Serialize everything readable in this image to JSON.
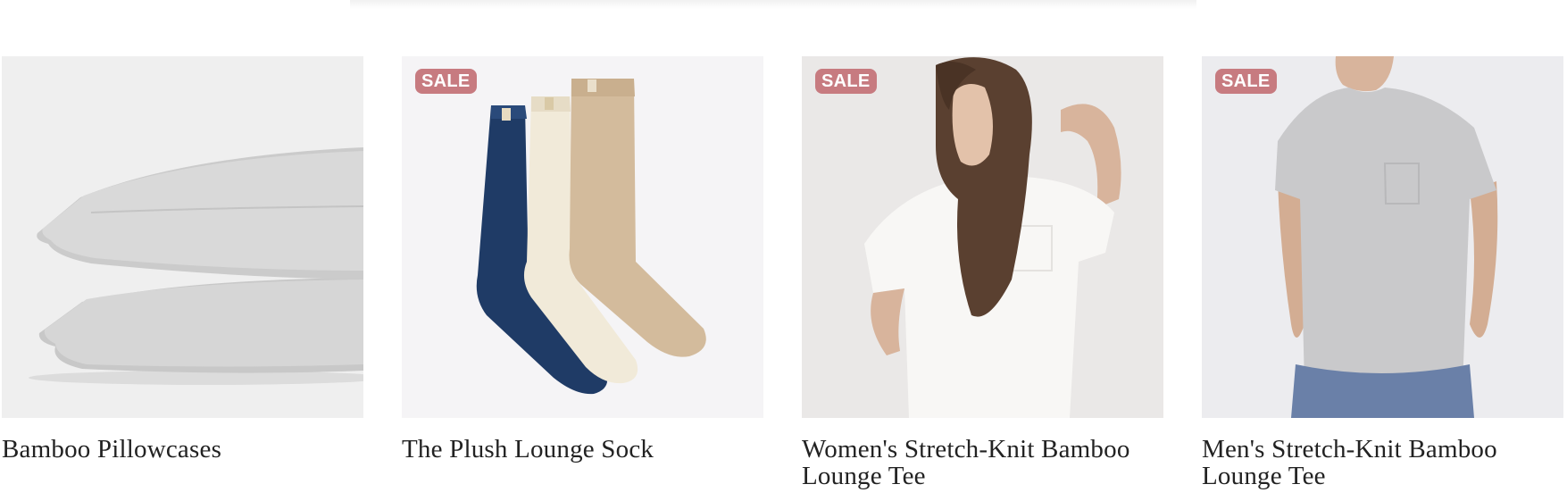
{
  "products": [
    {
      "title": "Bamboo Pillowcases",
      "badge": "",
      "image": "pillowcases-image"
    },
    {
      "title": "The Plush Lounge Sock",
      "badge": "SALE",
      "image": "socks-image"
    },
    {
      "title": "Women's Stretch-Knit Bamboo Lounge Tee",
      "badge": "SALE",
      "image": "womens-tee-image"
    },
    {
      "title": "Men's Stretch-Knit Bamboo Lounge Tee",
      "badge": "SALE",
      "image": "mens-tee-image"
    }
  ],
  "colors": {
    "badge_bg": "#c77b80",
    "badge_text": "#ffffff",
    "title_text": "#222222"
  }
}
